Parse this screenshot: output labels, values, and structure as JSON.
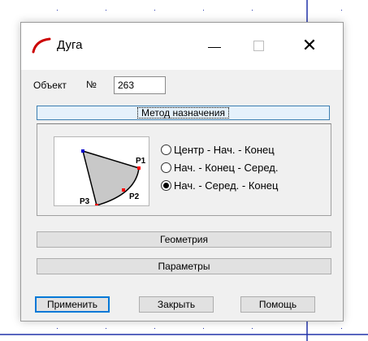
{
  "window": {
    "title": "Дуга",
    "icon": "arc-icon"
  },
  "object": {
    "label": "Объект",
    "number_label": "№",
    "number_value": "263"
  },
  "method": {
    "button_label": "Метод назначения",
    "diagram_points": {
      "p1": "P1",
      "p2": "P2",
      "p3": "P3"
    },
    "options": [
      {
        "label": "Центр - Нач. - Конец",
        "checked": false
      },
      {
        "label": "Нач. - Конец - Серед.",
        "checked": false
      },
      {
        "label": "Нач. -  Серед. - Конец",
        "checked": true
      }
    ]
  },
  "sections": {
    "geometry": "Геометрия",
    "parameters": "Параметры"
  },
  "footer": {
    "apply": "Применить",
    "close": "Закрыть",
    "help": "Помощь"
  },
  "colors": {
    "accent": "#0078d7",
    "arc_icon": "#cc0000",
    "arc_fill": "#c8c8c8",
    "point_marker": "#ff0000",
    "start_marker": "#0000cc"
  }
}
